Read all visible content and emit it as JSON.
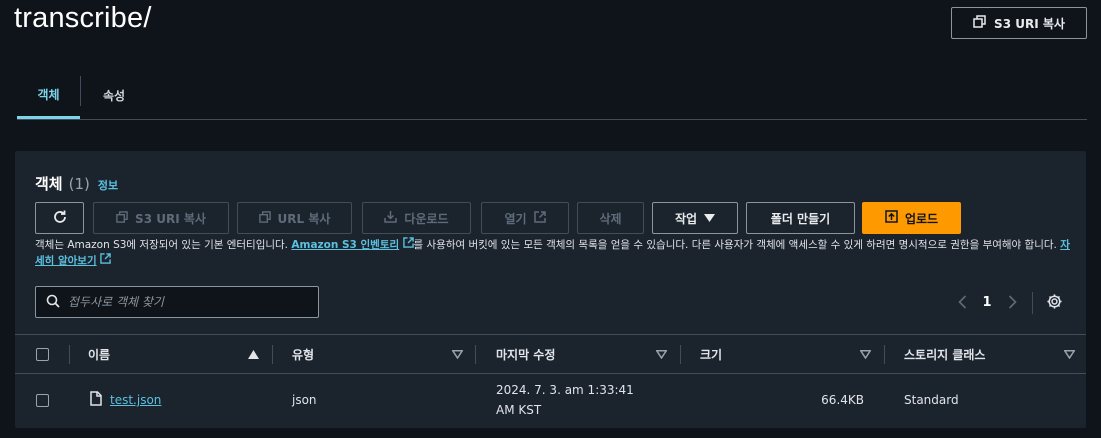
{
  "header": {
    "title": "transcribe/",
    "copy_s3_uri_label": "S3 URI 복사"
  },
  "tabs": [
    {
      "label": "객체",
      "active": true
    },
    {
      "label": "속성",
      "active": false
    }
  ],
  "objects_panel": {
    "title": "객체",
    "count": "(1)",
    "info_label": "정보",
    "toolbar": {
      "refresh_icon": "refresh-icon",
      "copy_s3_uri": "S3 URI 복사",
      "copy_url": "URL 복사",
      "download": "다운로드",
      "open": "열기",
      "delete": "삭제",
      "actions": "작업",
      "create_folder": "폴더 만들기",
      "upload": "업로드"
    },
    "description": {
      "part1": "객체는 Amazon S3에 저장되어 있는 기본 엔터티입니다. ",
      "inventory_link": "Amazon S3 인벤토리",
      "part2": "를 사용하여 버킷에 있는 모든 객체의 목록을 얻을 수 있습니다. 다른 사용자가 객체에 액세스할 수 있게 하려면 명시적으로 권한을 부여해야 합니다. ",
      "learn_more_link": "자세히 알아보기"
    },
    "search": {
      "placeholder": "접두사로 객체 찾기",
      "value": ""
    },
    "pagination": {
      "current_page": "1"
    },
    "table": {
      "columns": {
        "name": "이름",
        "type": "유형",
        "last_modified": "마지막 수정",
        "size": "크기",
        "storage_class": "스토리지 클래스"
      },
      "rows": [
        {
          "name": "test.json",
          "type": "json",
          "last_modified_line1": "2024. 7. 3. am 1:33:41",
          "last_modified_line2": "AM KST",
          "size": "66.4KB",
          "storage_class": "Standard"
        }
      ]
    }
  },
  "colors": {
    "background": "#0f141a",
    "panel": "#1b232d",
    "link": "#5bc1e0",
    "active_tab": "#7dd3e8",
    "primary_button": "#ff9900",
    "border": "#8c949e",
    "divider": "#414d5c"
  }
}
